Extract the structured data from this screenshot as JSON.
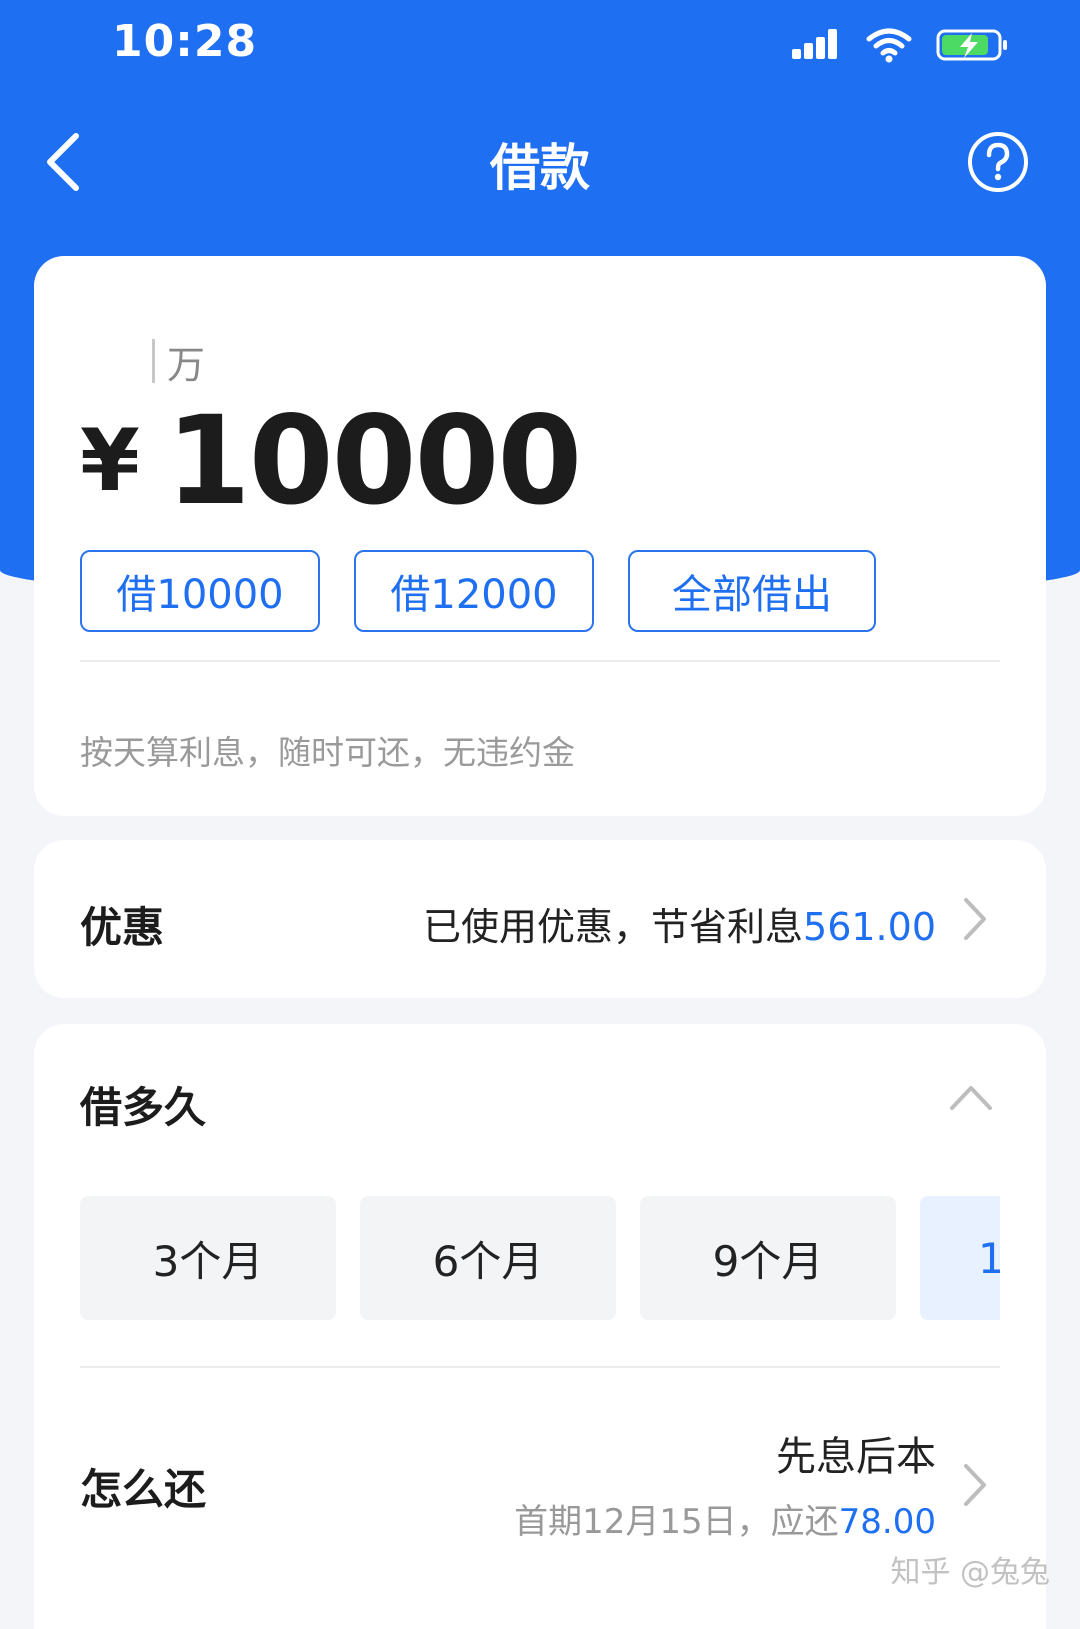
{
  "status_bar": {
    "time": "10:28"
  },
  "header": {
    "title": "借款"
  },
  "amount_card": {
    "unit_label": "万",
    "currency_symbol": "¥",
    "amount": "10000",
    "quick_options": [
      "借10000",
      "借12000",
      "全部借出"
    ],
    "hint": "按天算利息，随时可还，无违约金"
  },
  "discount": {
    "label": "优惠",
    "text": "已使用优惠，节省利息",
    "amount": "561.00"
  },
  "term": {
    "label": "借多久",
    "options": [
      "3个月",
      "6个月",
      "9个月",
      "1"
    ]
  },
  "repayment": {
    "label": "怎么还",
    "method": "先息后本",
    "first_period_text": "首期12月15日，应还",
    "first_period_amount": "78.00"
  },
  "watermark": "知乎 @兔兔",
  "colors": {
    "primary": "#1e6ff2",
    "background": "#f4f5f8"
  }
}
